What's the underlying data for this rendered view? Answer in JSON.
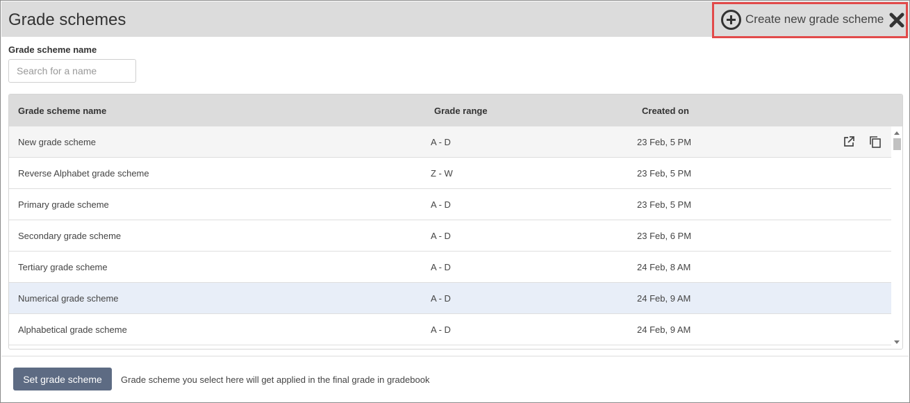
{
  "header": {
    "title": "Grade schemes",
    "create_label": "Create new grade scheme",
    "create_icon": "plus-circle-icon",
    "close_icon": "close-icon"
  },
  "search": {
    "label": "Grade scheme name",
    "placeholder": "Search for a name",
    "value": ""
  },
  "table": {
    "columns": [
      "Grade scheme name",
      "Grade range",
      "Created on"
    ],
    "rows": [
      {
        "name": "New grade scheme",
        "range": "A - D",
        "created": "23 Feb, 5 PM",
        "state": "hovered"
      },
      {
        "name": "Reverse Alphabet grade scheme",
        "range": "Z - W",
        "created": "23 Feb, 5 PM",
        "state": "normal"
      },
      {
        "name": "Primary grade scheme",
        "range": "A - D",
        "created": "23 Feb, 5 PM",
        "state": "normal"
      },
      {
        "name": "Secondary grade scheme",
        "range": "A - D",
        "created": "23 Feb, 6 PM",
        "state": "normal"
      },
      {
        "name": "Tertiary grade scheme",
        "range": "A - D",
        "created": "24 Feb, 8 AM",
        "state": "normal"
      },
      {
        "name": "Numerical grade scheme",
        "range": "A - D",
        "created": "24 Feb, 9 AM",
        "state": "selected"
      },
      {
        "name": "Alphabetical grade scheme",
        "range": "A - D",
        "created": "24 Feb, 9 AM",
        "state": "normal"
      }
    ],
    "row_actions": [
      "external-link-icon",
      "copy-icon"
    ]
  },
  "footer": {
    "button_label": "Set grade scheme",
    "note": "Grade scheme you select here will get applied in the final grade in gradebook"
  },
  "colors": {
    "header_bg": "#dcdcdc",
    "highlight_border": "#e24a4a",
    "row_hover": "#f5f5f5",
    "row_selected": "#e8eef8",
    "button_bg": "#5d6b83"
  }
}
